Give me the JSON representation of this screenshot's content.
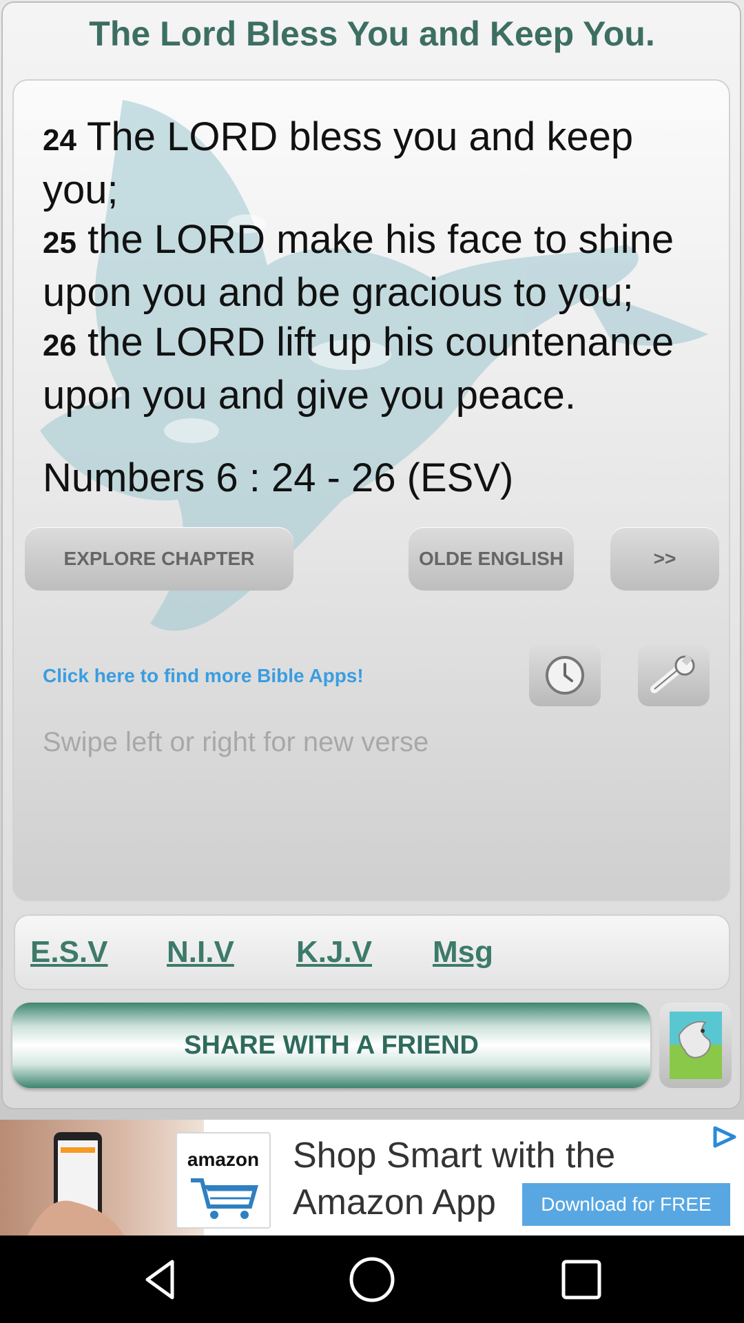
{
  "app": {
    "title": "The Lord Bless You and Keep You."
  },
  "verse": {
    "lines": [
      {
        "num": "24",
        "text": " The LORD bless you and keep you;"
      },
      {
        "num": "25",
        "text": " the LORD make his face to shine upon you and be gracious to you;"
      },
      {
        "num": "26",
        "text": " the LORD lift up his countenance upon you and give you peace."
      }
    ],
    "reference": "Numbers 6 : 24 - 26  (ESV)"
  },
  "buttons": {
    "explore_chapter": "EXPLORE CHAPTER",
    "olde_english": "OLDE ENGLISH",
    "next": ">>"
  },
  "links": {
    "more_apps": "Click here to find more Bible Apps!"
  },
  "hint": "Swipe left or right for new verse",
  "tabs": [
    {
      "label": "E.S.V"
    },
    {
      "label": "N.I.V"
    },
    {
      "label": "K.J.V"
    },
    {
      "label": "Msg"
    }
  ],
  "share": {
    "label": "SHARE WITH A FRIEND"
  },
  "ad": {
    "brand": "amazon",
    "line1": "Shop Smart with the",
    "line2": "Amazon App",
    "cta": "Download for FREE"
  },
  "icons": {
    "clock": "clock-icon",
    "settings": "wrench-icon",
    "dove": "dove-icon",
    "nav_back": "back-icon",
    "nav_home": "home-icon",
    "nav_recents": "recents-icon"
  },
  "colors": {
    "title": "#3d6e62",
    "link": "#3a9de0",
    "tab": "#3d7a6a",
    "share_text": "#2f6a5c"
  }
}
